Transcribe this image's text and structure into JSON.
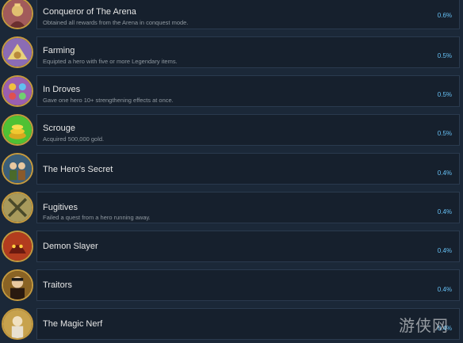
{
  "achievements": [
    {
      "name": "Conqueror of The Arena",
      "description": "Obtained all rewards from the Arena in conquest mode.",
      "percent": "0.6%",
      "icon": "arena-conqueror-icon",
      "icon_bg": "#a25b5b"
    },
    {
      "name": "Farming",
      "description": "Equipted a hero with five or more Legendary items.",
      "percent": "0.5%",
      "icon": "farming-icon",
      "icon_bg": "#8b6cb5"
    },
    {
      "name": "In Droves",
      "description": "Gave one hero 10+ strengthening effects at once.",
      "percent": "0.5%",
      "icon": "in-droves-icon",
      "icon_bg": "#9a5fb0"
    },
    {
      "name": "Scrouge",
      "description": "Acquired 500,000 gold.",
      "percent": "0.5%",
      "icon": "gold-coins-icon",
      "icon_bg": "#4fc134"
    },
    {
      "name": "The Hero's Secret",
      "description": "",
      "percent": "0.4%",
      "icon": "heroes-secret-icon",
      "icon_bg": "#3b5f7a"
    },
    {
      "name": "Fugitives",
      "description": "Failed a quest from a hero running away.",
      "percent": "0.4%",
      "icon": "crossed-swords-icon",
      "icon_bg": "#a89a5c"
    },
    {
      "name": "Demon Slayer",
      "description": "",
      "percent": "0.4%",
      "icon": "demon-icon",
      "icon_bg": "#b23c1e"
    },
    {
      "name": "Traitors",
      "description": "",
      "percent": "0.4%",
      "icon": "traitor-icon",
      "icon_bg": "#8a6324"
    },
    {
      "name": "The Magic Nerf",
      "description": "",
      "percent": "0.4%",
      "icon": "magic-nerf-icon",
      "icon_bg": "#c7a24d"
    }
  ],
  "watermark": "游侠网"
}
